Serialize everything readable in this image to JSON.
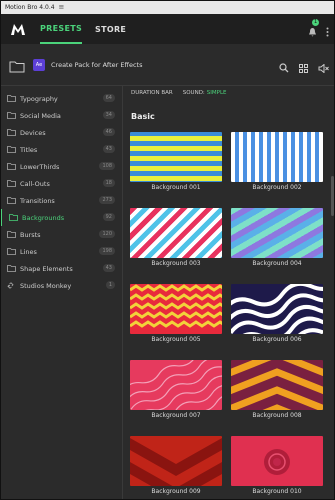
{
  "window": {
    "title": "Motion Bro 4.0.4"
  },
  "nav": {
    "presets": "PRESETS",
    "store": "STORE",
    "notification_count": "1"
  },
  "toolbar": {
    "create_pack": "Create Pack for After Effects",
    "pack_icon_text": "Ae"
  },
  "sidebar": {
    "items": [
      {
        "label": "Typography",
        "count": "64"
      },
      {
        "label": "Social Media",
        "count": "34"
      },
      {
        "label": "Devices",
        "count": "46"
      },
      {
        "label": "Titles",
        "count": "43"
      },
      {
        "label": "LowerThirds",
        "count": "108"
      },
      {
        "label": "Call-Outs",
        "count": "18"
      },
      {
        "label": "Transitions",
        "count": "273"
      },
      {
        "label": "Backgrounds",
        "count": "92"
      },
      {
        "label": "Bursts",
        "count": "120"
      },
      {
        "label": "Lines",
        "count": "198"
      },
      {
        "label": "Shape Elements",
        "count": "43"
      },
      {
        "label": "Studios Monkey",
        "count": "1"
      }
    ]
  },
  "main": {
    "duration": "DURATION BAR",
    "sound_label": "SOUND:",
    "sound_value": "SIMPLE",
    "section": "Basic"
  },
  "cards": [
    {
      "label": "Background 001"
    },
    {
      "label": "Background 002"
    },
    {
      "label": "Background 003"
    },
    {
      "label": "Background 004"
    },
    {
      "label": "Background 005"
    },
    {
      "label": "Background 006"
    },
    {
      "label": "Background 007"
    },
    {
      "label": "Background 008"
    },
    {
      "label": "Background 009"
    },
    {
      "label": "Background 010"
    }
  ],
  "colors": {
    "accent": "#4bd37b",
    "pack": "#5c3fd6"
  }
}
